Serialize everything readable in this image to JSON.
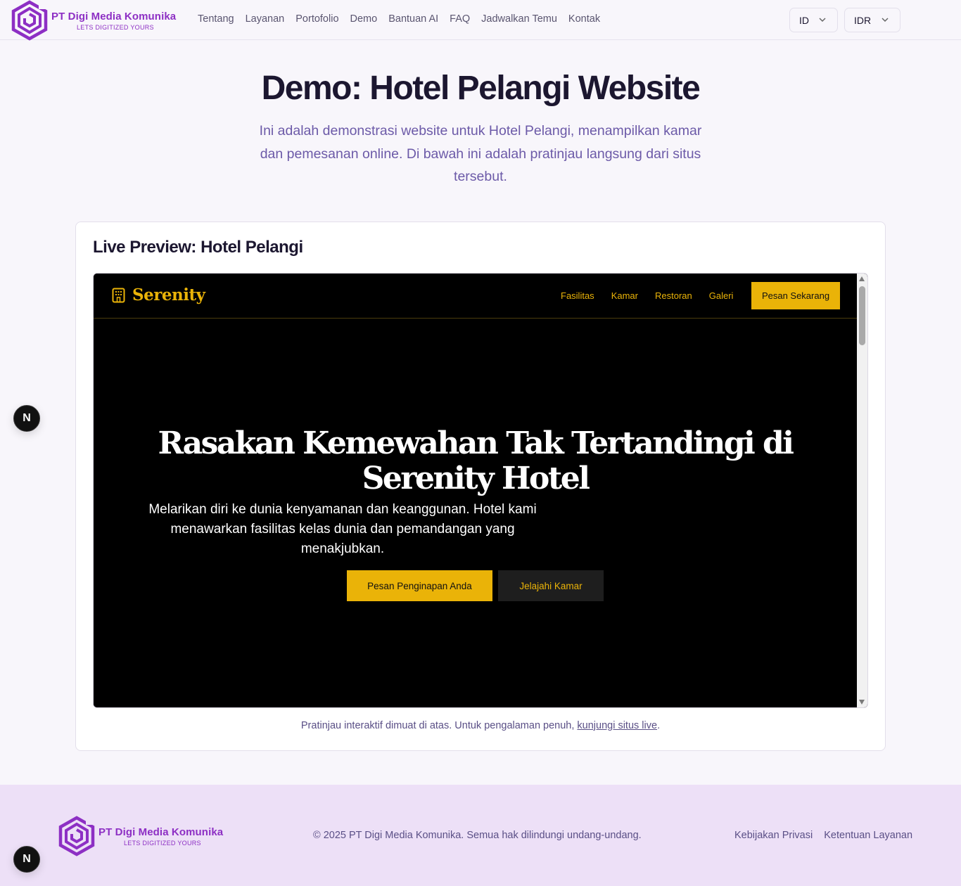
{
  "brand": {
    "name": "PT Digi Media Komunika",
    "tagline": "LETS DIGITIZED YOURS",
    "color": "#8d2fc4"
  },
  "nav": {
    "links": [
      "Tentang",
      "Layanan",
      "Portofolio",
      "Demo",
      "Bantuan AI",
      "FAQ",
      "Jadwalkan Temu",
      "Kontak"
    ],
    "language": "ID",
    "currency": "IDR"
  },
  "hero": {
    "title": "Demo: Hotel Pelangi Website",
    "description": "Ini adalah demonstrasi website untuk Hotel Pelangi, menampilkan kamar dan pemesanan online. Di bawah ini adalah pratinjau langsung dari situs tersebut."
  },
  "preview": {
    "title": "Live Preview: Hotel Pelangi",
    "site": {
      "brand": "Serenity",
      "nav_links": [
        "Fasilitas",
        "Kamar",
        "Restoran",
        "Galeri"
      ],
      "cta": "Pesan Sekarang",
      "headline": "Rasakan Kemewahan Tak Tertandingi di Serenity Hotel",
      "subtext": "Melarikan diri ke dunia kenyamanan dan keanggunan. Hotel kami menawarkan fasilitas kelas dunia dan pemandangan yang menakjubkan.",
      "primary_button": "Pesan Penginapan Anda",
      "secondary_button": "Jelajahi Kamar",
      "accent_color": "#eab308"
    },
    "note_prefix": "Pratinjau interaktif dimuat di atas. Untuk pengalaman penuh, ",
    "note_link": "kunjungi situs live",
    "note_suffix": "."
  },
  "fab_label": "N",
  "footer": {
    "copyright": "© 2025 PT Digi Media Komunika. Semua hak dilindungi undang-undang.",
    "links": [
      "Kebijakan Privasi",
      "Ketentuan Layanan"
    ],
    "background": "#ede0f7"
  }
}
